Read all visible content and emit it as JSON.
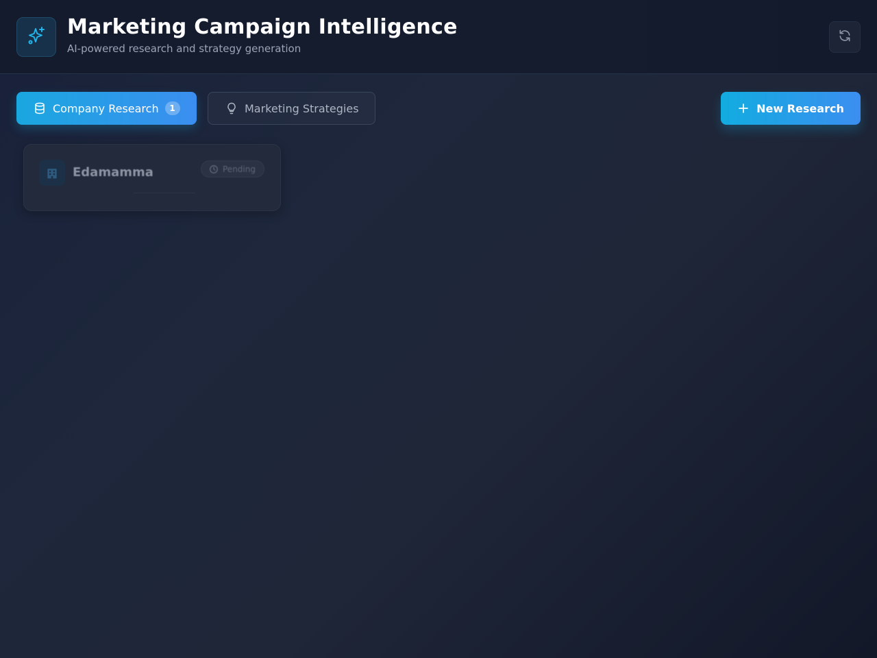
{
  "header": {
    "logo_icon": "sparkles-icon",
    "title": "Marketing Campaign Intelligence",
    "subtitle": "AI-powered research and strategy generation",
    "refresh_icon": "refresh-icon"
  },
  "tabs": [
    {
      "label": "Company Research",
      "icon": "database-icon",
      "count": "1",
      "active": true
    },
    {
      "label": "Marketing Strategies",
      "icon": "lightbulb-icon",
      "active": false
    }
  ],
  "actions": {
    "new_research_label": "New Research",
    "new_research_icon": "plus-icon"
  },
  "research_cards": [
    {
      "company": "Edamamma",
      "status": "Pending",
      "icon": "building-icon",
      "status_icon": "clock-icon"
    }
  ],
  "colors": {
    "accent": "#1aa7e0",
    "accent_end": "#3b8ef0",
    "background": "#1e273b"
  }
}
